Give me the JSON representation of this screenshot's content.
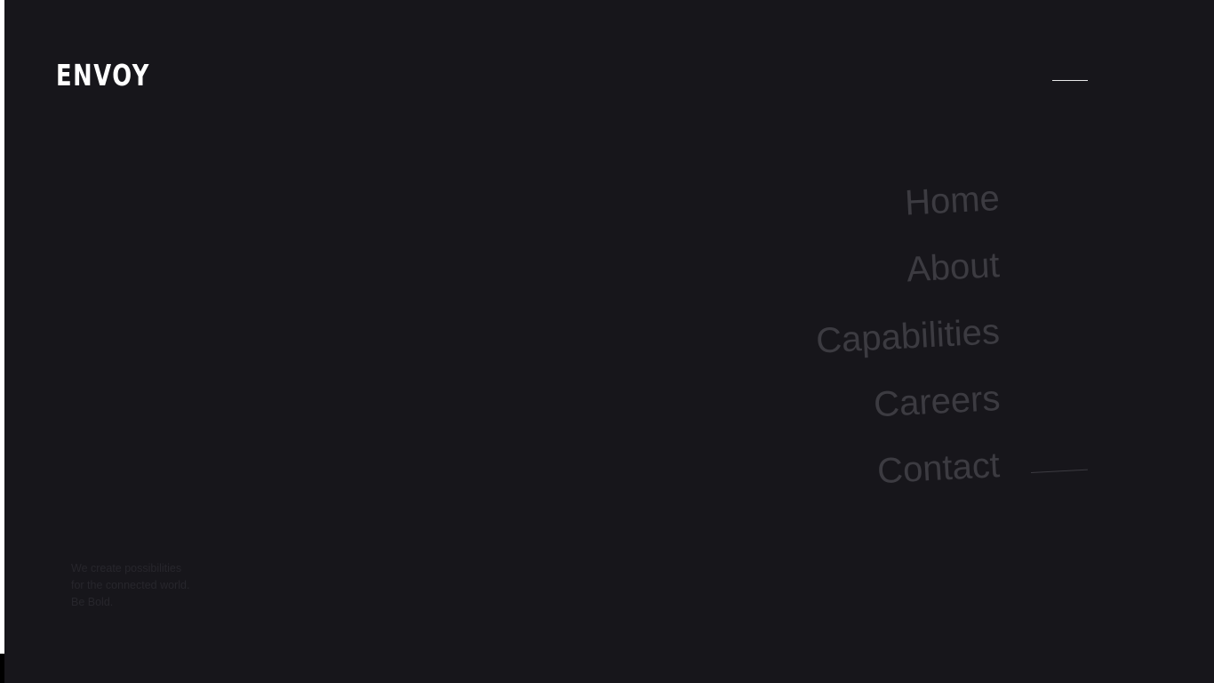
{
  "brand": {
    "logo_text": "ENVOY"
  },
  "menu": {
    "toggle_icon": "hamburger-line-icon"
  },
  "nav": {
    "items": [
      {
        "label": "Home"
      },
      {
        "label": "About"
      },
      {
        "label": "Capabilities"
      },
      {
        "label": "Careers"
      },
      {
        "label": "Contact"
      }
    ]
  },
  "tagline": {
    "lines": [
      "We create possibilities",
      "for the connected world.",
      "Be Bold."
    ]
  },
  "colors": {
    "background": "#17161b",
    "logo": "#ffffff",
    "nav_text": "#3c3b41",
    "tagline_text": "#27262c"
  }
}
